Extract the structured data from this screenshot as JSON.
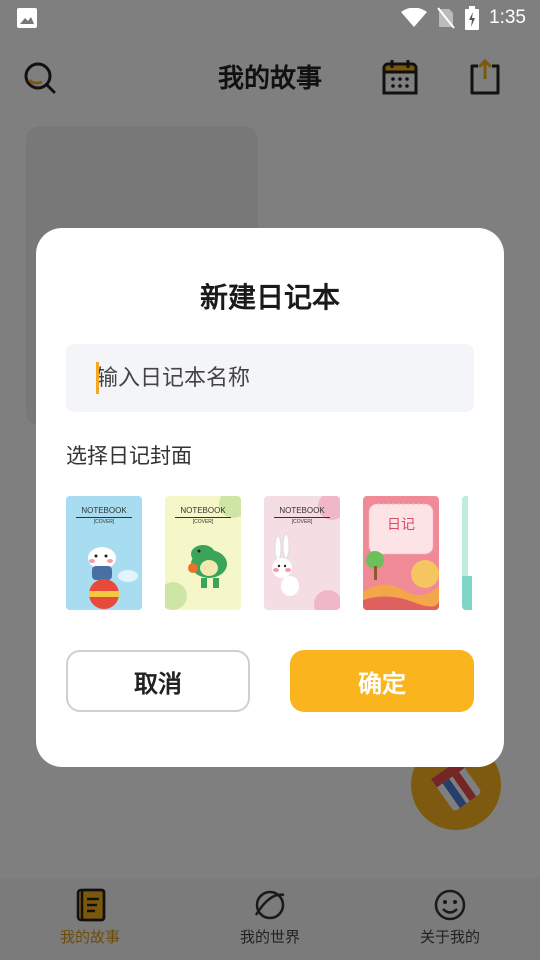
{
  "status_bar": {
    "time": "1:35"
  },
  "header": {
    "title": "我的故事"
  },
  "dialog": {
    "title": "新建日记本",
    "input_placeholder": "输入日记本名称",
    "input_value": "",
    "cover_section_label": "选择日记封面",
    "covers": [
      {
        "title": "NOTEBOOK",
        "subtitle": "[COVER]",
        "theme": "cat",
        "bg": "#a8dcf0"
      },
      {
        "title": "NOTEBOOK",
        "subtitle": "[COVER]",
        "theme": "dinosaur",
        "bg": "#f5f7c8"
      },
      {
        "title": "NOTEBOOK",
        "subtitle": "[COVER]",
        "theme": "rabbit",
        "bg": "#f5dde4"
      },
      {
        "title": "日记",
        "theme": "landscape",
        "bg": "#f08a96"
      },
      {
        "theme": "mint",
        "bg": "#bfeee0"
      }
    ],
    "cancel_label": "取消",
    "confirm_label": "确定"
  },
  "bottom_nav": [
    {
      "label": "我的故事",
      "icon": "notebook-icon",
      "active": true
    },
    {
      "label": "我的世界",
      "icon": "planet-icon",
      "active": false
    },
    {
      "label": "关于我的",
      "icon": "smiley-icon",
      "active": false
    }
  ],
  "colors": {
    "accent": "#fab51e",
    "active_nav": "#d89b12"
  }
}
